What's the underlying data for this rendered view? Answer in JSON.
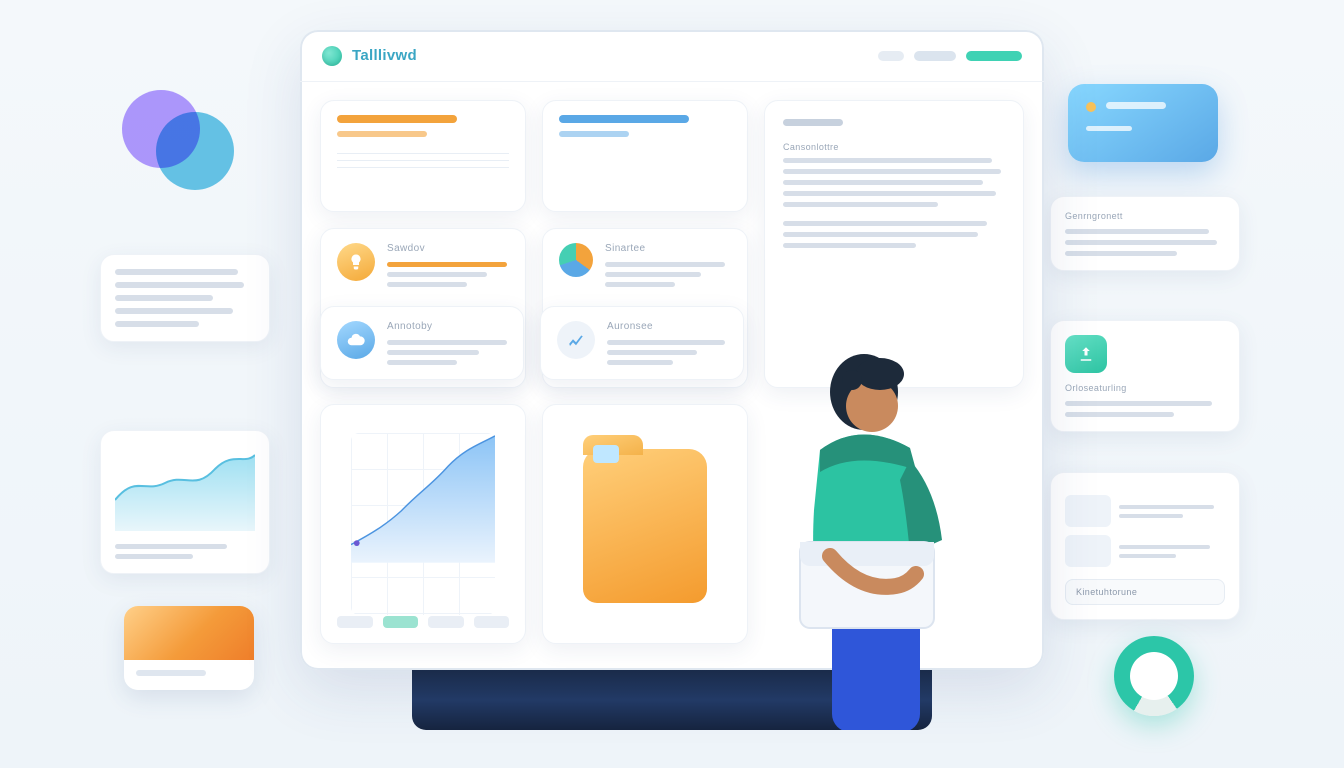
{
  "brand": {
    "name": "Talllivwd"
  },
  "colors": {
    "accent_teal": "#2cc6a8",
    "accent_blue": "#5aa8e6",
    "accent_orange": "#f3a33c",
    "accent_purple": "#8b72ff"
  },
  "header": {
    "actions": [
      "toggle",
      "nav",
      "cta"
    ]
  },
  "cards": {
    "features": [
      {
        "id": "sawdov",
        "label": "Sawdov"
      },
      {
        "id": "sinartee",
        "label": "Sinartee"
      },
      {
        "id": "annotoby",
        "label": "Annotoby"
      },
      {
        "id": "auronsee",
        "label": "Auronsee"
      }
    ],
    "panel": {
      "section_label": "Cansonlottre"
    }
  },
  "right_cards": {
    "rc1_title": "Genrngronett",
    "rc2_title": "Orloseaturling",
    "rc3_title": "",
    "rc3_cta": "Kinetuhtorune"
  },
  "chart_data": [
    {
      "type": "area",
      "id": "main-area-chart",
      "title": "",
      "xlabel": "",
      "ylabel": "",
      "series": [
        {
          "name": "primary",
          "color": "#5aa8e6",
          "x": [
            0,
            1,
            2,
            3,
            4,
            5,
            6,
            7,
            8,
            9
          ],
          "values": [
            8,
            12,
            18,
            22,
            30,
            38,
            50,
            62,
            70,
            82
          ]
        },
        {
          "name": "shadow",
          "color": "#cfe6fb",
          "x": [
            0,
            1,
            2,
            3,
            4,
            5,
            6,
            7,
            8,
            9
          ],
          "values": [
            5,
            8,
            12,
            15,
            20,
            26,
            34,
            44,
            52,
            60
          ]
        }
      ],
      "xlim": [
        0,
        9
      ],
      "ylim": [
        0,
        100
      ]
    },
    {
      "type": "area",
      "id": "left-mini-chart",
      "series": [
        {
          "name": "teal",
          "color": "#67d3e8",
          "x": [
            0,
            1,
            2,
            3,
            4,
            5
          ],
          "values": [
            15,
            35,
            28,
            50,
            42,
            60
          ]
        }
      ],
      "xlim": [
        0,
        5
      ],
      "ylim": [
        0,
        70
      ]
    },
    {
      "type": "pie",
      "id": "feature-pie",
      "slices": [
        {
          "name": "a",
          "value": 35,
          "color": "#f3a33c"
        },
        {
          "name": "b",
          "value": 35,
          "color": "#5aa8e6"
        },
        {
          "name": "c",
          "value": 30,
          "color": "#45cfb3"
        }
      ]
    },
    {
      "type": "pie",
      "id": "progress-ring",
      "slices": [
        {
          "name": "done",
          "value": 82,
          "color": "#2cc6a8"
        },
        {
          "name": "rest",
          "value": 18,
          "color": "#e7f0ee"
        }
      ]
    }
  ]
}
